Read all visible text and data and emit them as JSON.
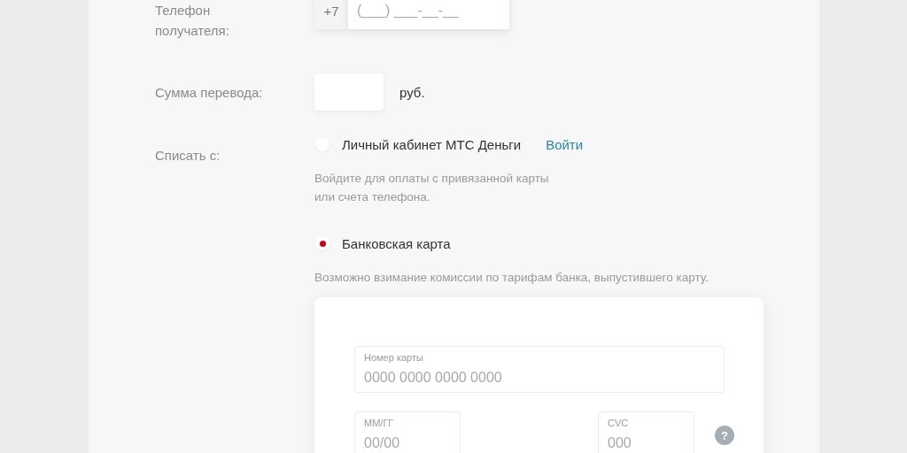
{
  "recipient_phone": {
    "label": "Телефон получателя:",
    "prefix": "+7",
    "placeholder": "(___) ___-__-__"
  },
  "amount": {
    "label": "Сумма перевода:",
    "currency": "руб."
  },
  "payment_source": {
    "label": "Списать с:",
    "options": [
      {
        "label": "Личный кабинет МТС Деньги",
        "selected": false,
        "link": "Войти",
        "note_lines": [
          "Войдите для оплаты с привязанной карты",
          "или счета телефона."
        ]
      },
      {
        "label": "Банковская карта",
        "selected": true,
        "note_lines": [
          "Возможно взимание комиссии по тарифам банка, выпустившего карту."
        ]
      }
    ]
  },
  "card_form": {
    "fields": [
      {
        "label": "Номер карты",
        "placeholder": "0000 0000 0000 0000"
      },
      {
        "label": "ММ/ГГ",
        "placeholder": "00/00"
      },
      {
        "label": "CVC",
        "placeholder": "000"
      }
    ],
    "help_mark": "?"
  }
}
